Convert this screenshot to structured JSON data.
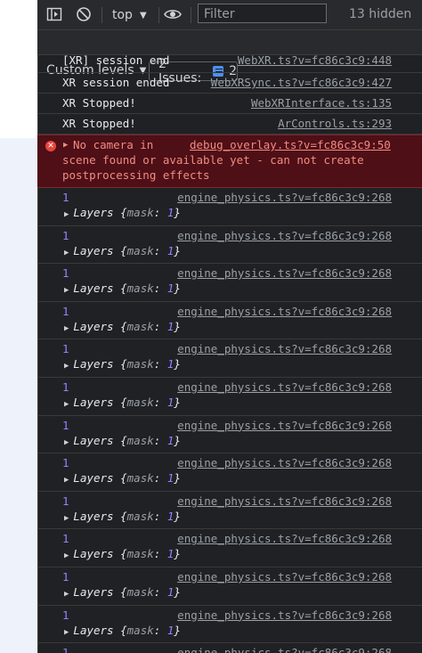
{
  "toolbar": {
    "context": "top",
    "filter_placeholder": "Filter",
    "hidden_count": "13 hidden",
    "levels_label": "Custom levels",
    "issues_label": "2 Issues:",
    "issues_count": "2"
  },
  "messages": [
    {
      "text": "[XR] session end",
      "source": "WebXR.ts?v=fc86c3c9:448"
    },
    {
      "text": "XR session ended",
      "source": "WebXRSync.ts?v=fc86c3c9:427"
    },
    {
      "text": "XR Stopped!",
      "source": "WebXRInterface.ts:135"
    },
    {
      "text": "XR Stopped!",
      "source": "ArControls.ts:293"
    }
  ],
  "error": {
    "line1": "No camera in",
    "source": "debug_overlay.ts?v=fc86c3c9:50",
    "line2": "scene found or available yet - can not create",
    "line3": "postprocessing effects"
  },
  "log_entry": {
    "value": "1",
    "source": "engine_physics.ts?v=fc86c3c9:268",
    "object_label": "Layers",
    "object_open": "{",
    "object_key": "mask",
    "object_colon": ": ",
    "object_value": "1",
    "object_close": "}"
  },
  "log_repeat_count": 13,
  "colors": {
    "background": "#202124",
    "error_background": "#4e0f16",
    "error_text": "#f28b82",
    "number": "#9980ff",
    "link": "#9aa0a6",
    "issue_badge": "#4d8ff0"
  }
}
